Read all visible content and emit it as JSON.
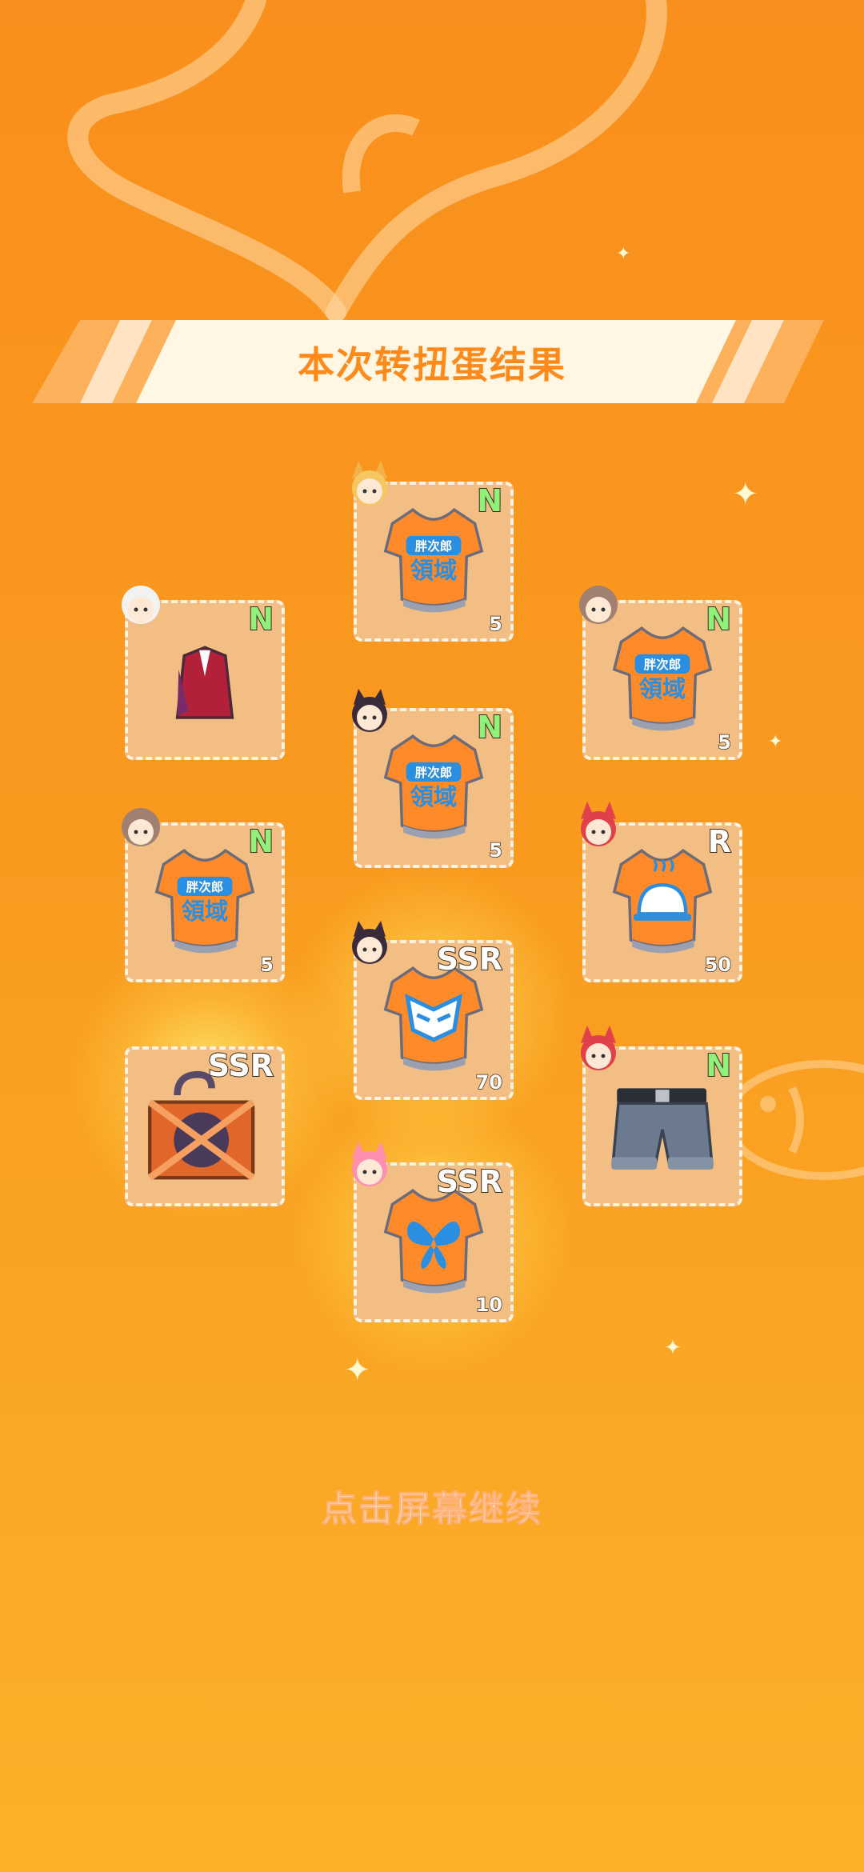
{
  "banner": {
    "title": "本次转扭蛋结果"
  },
  "items": [
    {
      "id": "c1",
      "rarity": "N",
      "count": "5",
      "art": "tshirt-logo"
    },
    {
      "id": "c2",
      "rarity": "N",
      "count": "",
      "art": "red-outfit"
    },
    {
      "id": "c3",
      "rarity": "N",
      "count": "5",
      "art": "tshirt-logo"
    },
    {
      "id": "c4",
      "rarity": "N",
      "count": "5",
      "art": "tshirt-logo"
    },
    {
      "id": "c5",
      "rarity": "N",
      "count": "5",
      "art": "tshirt-logo"
    },
    {
      "id": "c6",
      "rarity": "R",
      "count": "50",
      "art": "tshirt-dome"
    },
    {
      "id": "c7",
      "rarity": "SSR",
      "count": "70",
      "art": "tshirt-mask"
    },
    {
      "id": "c8",
      "rarity": "SSR",
      "count": "",
      "art": "crate"
    },
    {
      "id": "c9",
      "rarity": "N",
      "count": "",
      "art": "denim-shorts"
    },
    {
      "id": "c10",
      "rarity": "SSR",
      "count": "10",
      "art": "tshirt-butterfly"
    }
  ],
  "tshirt_logo_text": {
    "line1": "胖次郎",
    "line2": "領域"
  },
  "footer": {
    "continue_label": "点击屏幕继续"
  },
  "colors": {
    "background": "#f98f1c",
    "card": "#f2be83",
    "rarity_n": "#8ff07a",
    "shirt": "#ff8a2a",
    "accent_blue": "#2a8fe0"
  }
}
